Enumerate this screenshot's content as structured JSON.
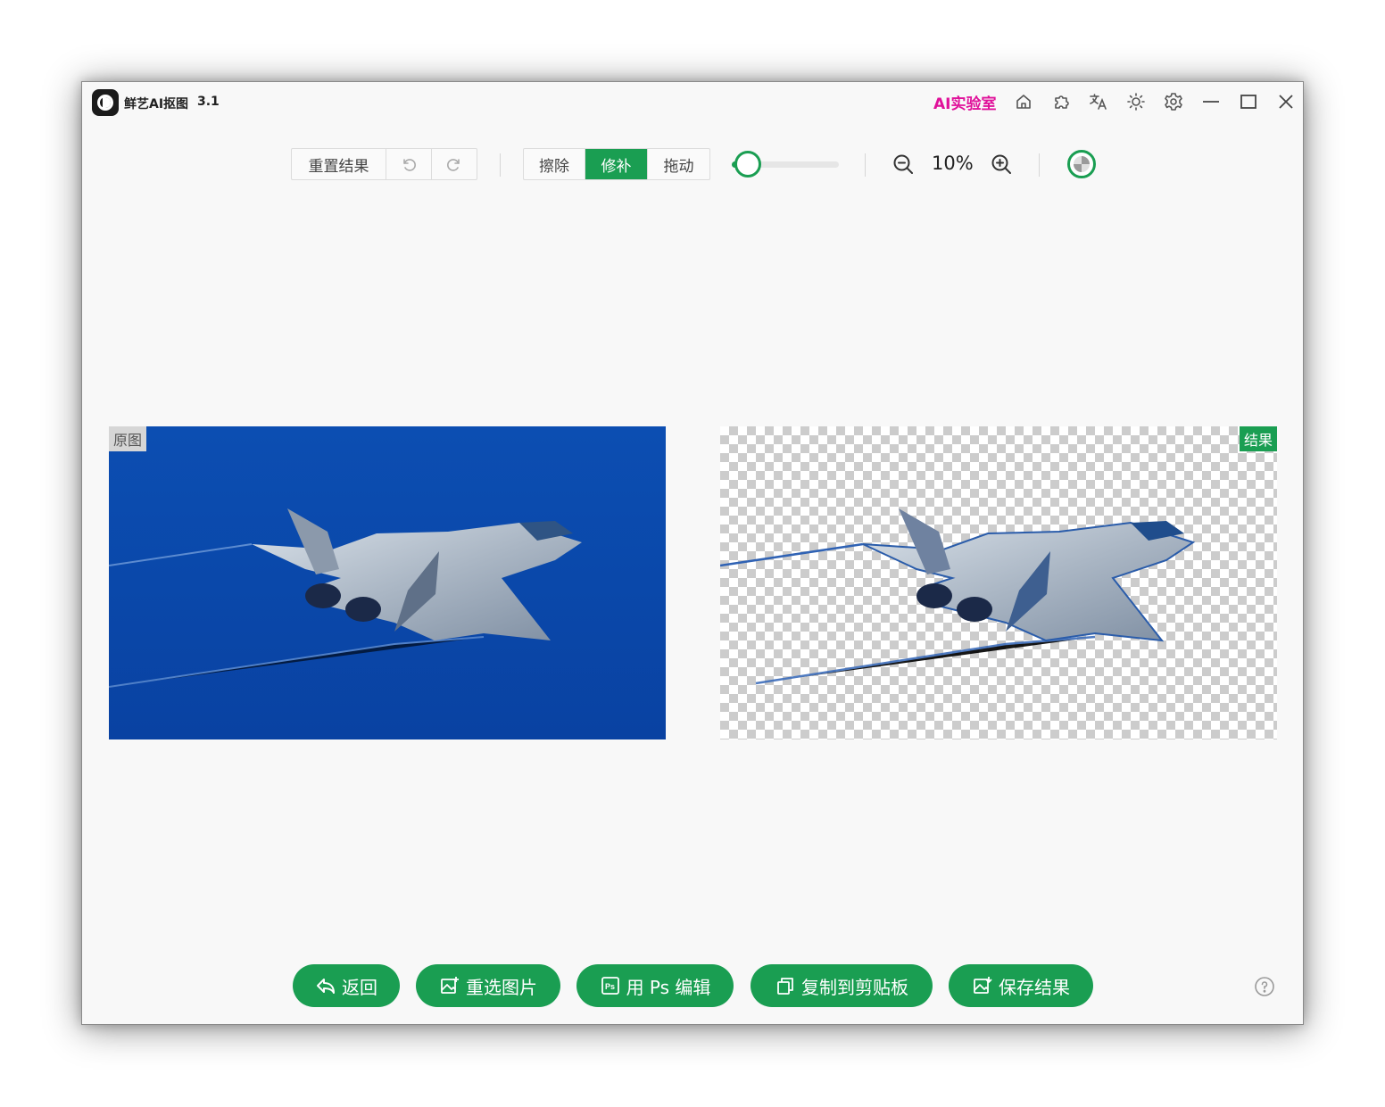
{
  "app": {
    "title": "鲜艺AI抠图",
    "version": "3.1",
    "ai_lab": "AI实验室"
  },
  "titlebar_icons": [
    "home-icon",
    "puzzle-icon",
    "translate-icon",
    "sun-icon",
    "settings-icon",
    "minimize-icon",
    "maximize-icon",
    "close-icon"
  ],
  "toolbar": {
    "reset_label": "重置结果",
    "undo_icon": "undo-icon",
    "redo_icon": "redo-icon",
    "modes": [
      "擦除",
      "修补",
      "拖动"
    ],
    "active_mode": "修补",
    "brush_size_level": 0.15,
    "zoom_level": "10%"
  },
  "panels": {
    "original_label": "原图",
    "result_label": "结果"
  },
  "actions": {
    "back": "返回",
    "reselect": "重选图片",
    "ps_edit": "用 Ps 编辑",
    "copy": "复制到剪贴板",
    "save": "保存结果"
  },
  "colors": {
    "accent": "#1a9e52",
    "ai_lab": "#e0119a",
    "original_bg": "#0a48aa"
  }
}
